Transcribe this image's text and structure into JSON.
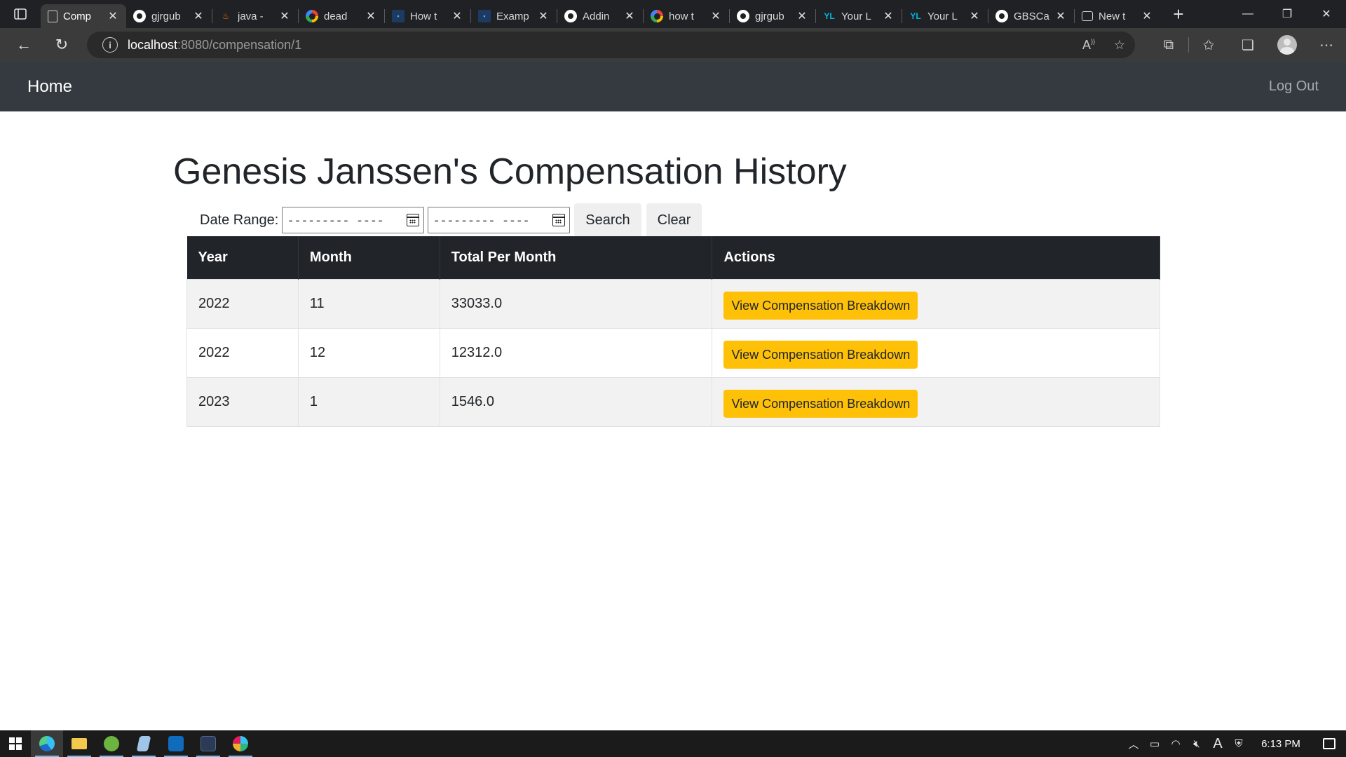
{
  "browser": {
    "tabs": [
      {
        "title": "Comp",
        "icon": "page-icon",
        "active": true
      },
      {
        "title": "gjrgub",
        "icon": "github-icon"
      },
      {
        "title": "java -",
        "icon": "java-icon"
      },
      {
        "title": "dead",
        "icon": "google-icon"
      },
      {
        "title": "How t",
        "icon": "doc-icon"
      },
      {
        "title": "Examp",
        "icon": "doc-icon"
      },
      {
        "title": "Addin",
        "icon": "github-icon"
      },
      {
        "title": "how t",
        "icon": "google-icon"
      },
      {
        "title": "gjrgub",
        "icon": "github-icon"
      },
      {
        "title": "Your L",
        "icon": "yl-icon"
      },
      {
        "title": "Your L",
        "icon": "yl-icon"
      },
      {
        "title": "GBSCa",
        "icon": "github-icon"
      },
      {
        "title": "New t",
        "icon": "newtab-icon"
      }
    ],
    "url_host": "localhost",
    "url_path": ":8080/compensation/1"
  },
  "navbar": {
    "home_label": "Home",
    "logout_label": "Log Out"
  },
  "page": {
    "title": "Genesis Janssen's Compensation History",
    "date_range_label": "Date Range:",
    "date_placeholder": "---------  ----",
    "search_label": "Search",
    "clear_label": "Clear"
  },
  "table": {
    "headers": [
      "Year",
      "Month",
      "Total Per Month",
      "Actions"
    ],
    "rows": [
      {
        "year": "2022",
        "month": "11",
        "total": "33033.0",
        "action": "View Compensation Breakdown"
      },
      {
        "year": "2022",
        "month": "12",
        "total": "12312.0",
        "action": "View Compensation Breakdown"
      },
      {
        "year": "2023",
        "month": "1",
        "total": "1546.0",
        "action": "View Compensation Breakdown"
      }
    ]
  },
  "taskbar": {
    "time": "6:13 PM"
  },
  "colors": {
    "navbar_bg": "#343a40",
    "table_header_bg": "#212529",
    "action_button": "#ffc107"
  }
}
